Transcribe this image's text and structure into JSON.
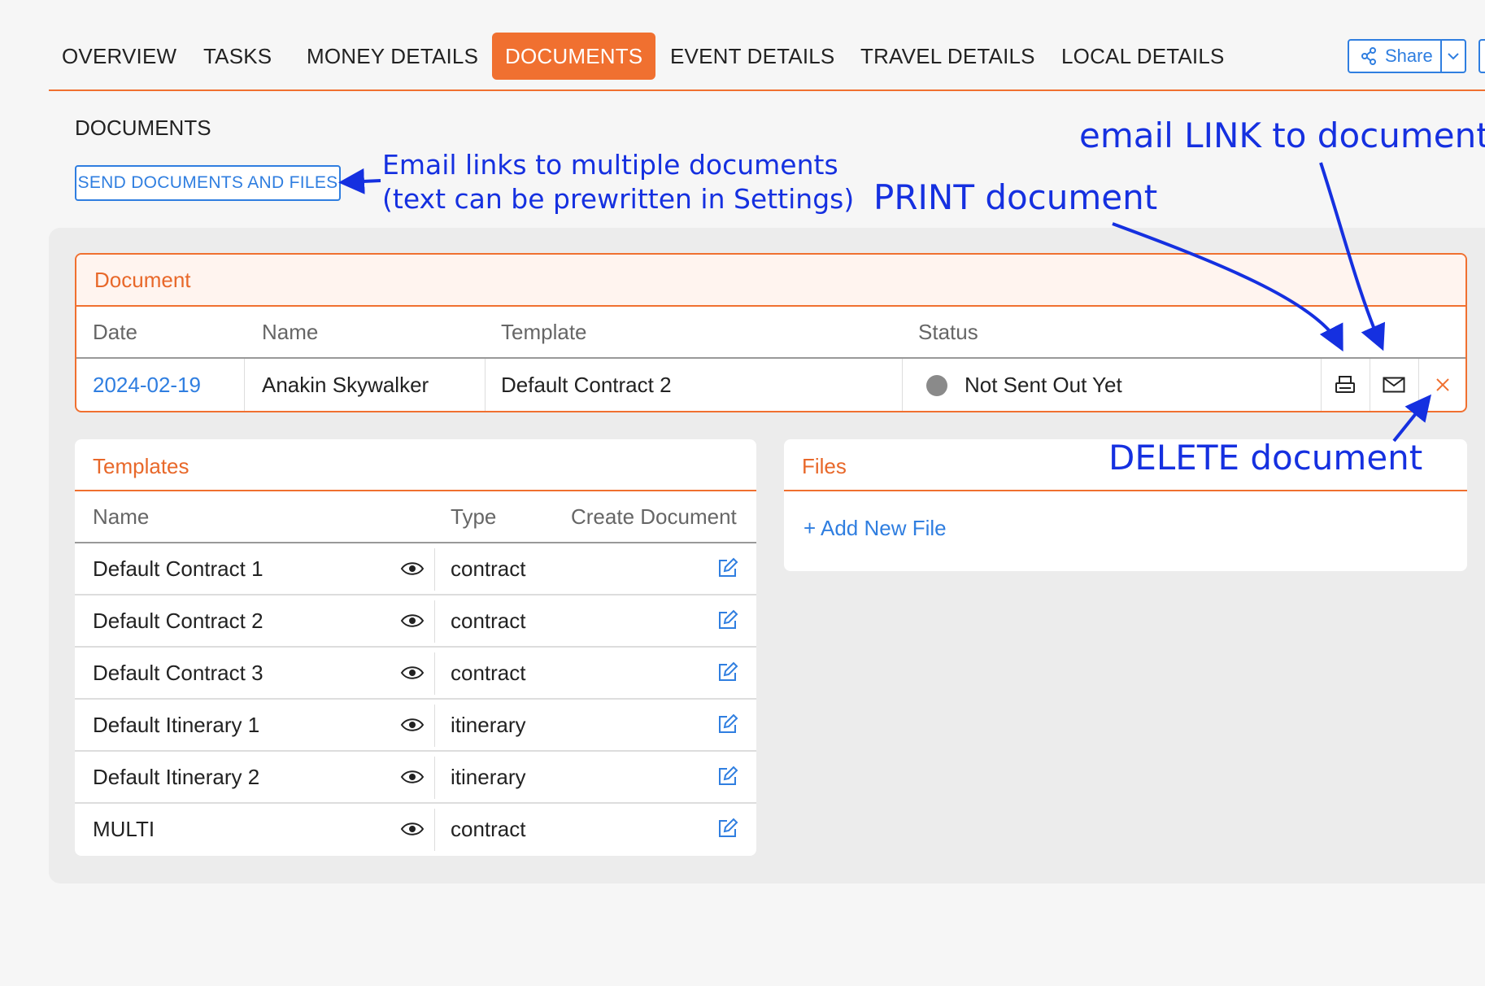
{
  "tabs": [
    {
      "label": "OVERVIEW",
      "active": false
    },
    {
      "label": "TASKS",
      "active": false
    },
    {
      "label": "MONEY DETAILS",
      "active": false
    },
    {
      "label": "DOCUMENTS",
      "active": true
    },
    {
      "label": "EVENT DETAILS",
      "active": false
    },
    {
      "label": "TRAVEL DETAILS",
      "active": false
    },
    {
      "label": "LOCAL DETAILS",
      "active": false
    }
  ],
  "share": {
    "label": "Share"
  },
  "section_title": "DOCUMENTS",
  "send_button": "SEND DOCUMENTS AND FILES",
  "document_card": {
    "title": "Document",
    "columns": [
      "Date",
      "Name",
      "Template",
      "Status"
    ],
    "row": {
      "date": "2024-02-19",
      "name": "Anakin Skywalker",
      "template": "Default Contract 2",
      "status": "Not Sent Out Yet"
    }
  },
  "templates_card": {
    "title": "Templates",
    "columns": [
      "Name",
      "Type",
      "Create Document"
    ],
    "rows": [
      {
        "name": "Default Contract 1",
        "type": "contract"
      },
      {
        "name": "Default Contract 2",
        "type": "contract"
      },
      {
        "name": "Default Contract 3",
        "type": "contract"
      },
      {
        "name": "Default Itinerary 1",
        "type": "itinerary"
      },
      {
        "name": "Default Itinerary 2",
        "type": "itinerary"
      },
      {
        "name": "MULTI",
        "type": "contract"
      }
    ]
  },
  "files_card": {
    "title": "Files",
    "add_label": "+ Add New File"
  },
  "annotations": {
    "send_line1": "Email links to multiple documents",
    "send_line2": "(text can be prewritten in Settings)",
    "print": "PRINT document",
    "email": "email LINK to document",
    "delete": "DELETE document"
  },
  "icons": {
    "share": "share-icon",
    "caret": "chevron-down-icon",
    "print": "printer-icon",
    "email": "envelope-icon",
    "delete": "close-icon",
    "view": "eye-icon",
    "create": "edit-icon"
  },
  "colors": {
    "accent": "#f07030",
    "link": "#2f7ee0",
    "annotation": "#1530e0",
    "status_dot": "#8a8a8a"
  }
}
